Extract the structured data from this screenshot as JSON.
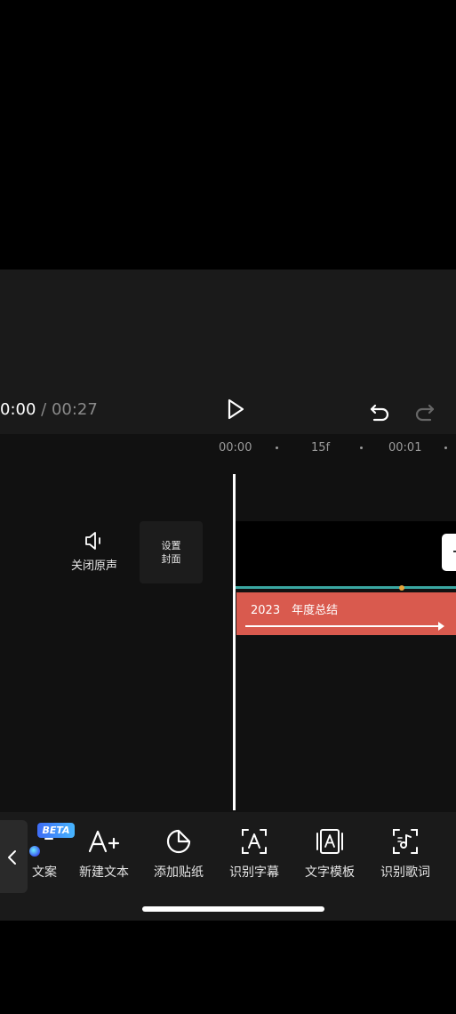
{
  "player": {
    "current_time": "0:00",
    "separator": " / ",
    "total_time": "00:27"
  },
  "ruler": {
    "labels": [
      "00:00",
      "15f",
      "00:01"
    ]
  },
  "track_controls": {
    "mute_label": "关闭原声",
    "cover_line1": "设置",
    "cover_line2": "封面"
  },
  "text_clip": {
    "label": "2023　年度总结",
    "color": "#d95a4e"
  },
  "toolbar": {
    "beta_badge": "BETA",
    "items": [
      {
        "label": "文案",
        "icon": "ai-copywriting-icon"
      },
      {
        "label": "新建文本",
        "icon": "add-text-icon"
      },
      {
        "label": "添加贴纸",
        "icon": "sticker-icon"
      },
      {
        "label": "识别字幕",
        "icon": "recognize-subtitle-icon"
      },
      {
        "label": "文字模板",
        "icon": "text-template-icon"
      },
      {
        "label": "识别歌词",
        "icon": "recognize-lyrics-icon"
      }
    ]
  },
  "colors": {
    "accent_track": "#3aa7a2",
    "keyframe_dot": "#e8a43b",
    "panel_bg": "#1a1a1a"
  }
}
